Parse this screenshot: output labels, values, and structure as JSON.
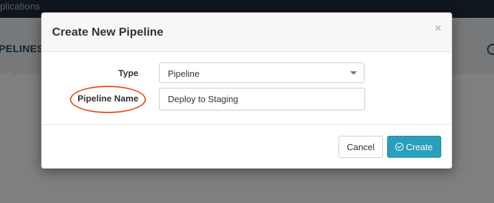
{
  "background": {
    "topbar_label": "plications",
    "nav_tab_label": "PELINES"
  },
  "modal": {
    "title": "Create New Pipeline",
    "close_glyph": "×",
    "form": {
      "type_label": "Type",
      "type_value": "Pipeline",
      "name_label": "Pipeline Name",
      "name_value": "Deploy to Staging"
    },
    "buttons": {
      "cancel_label": "Cancel",
      "create_label": "Create"
    }
  },
  "colors": {
    "primary_button": "#2a9fbc",
    "highlight_ring": "#e8572a",
    "topbar": "#1f2d3a"
  },
  "icons": {
    "create_button_icon": "check-circle-icon",
    "select_caret": "chevron-down-icon",
    "close": "close-icon"
  }
}
